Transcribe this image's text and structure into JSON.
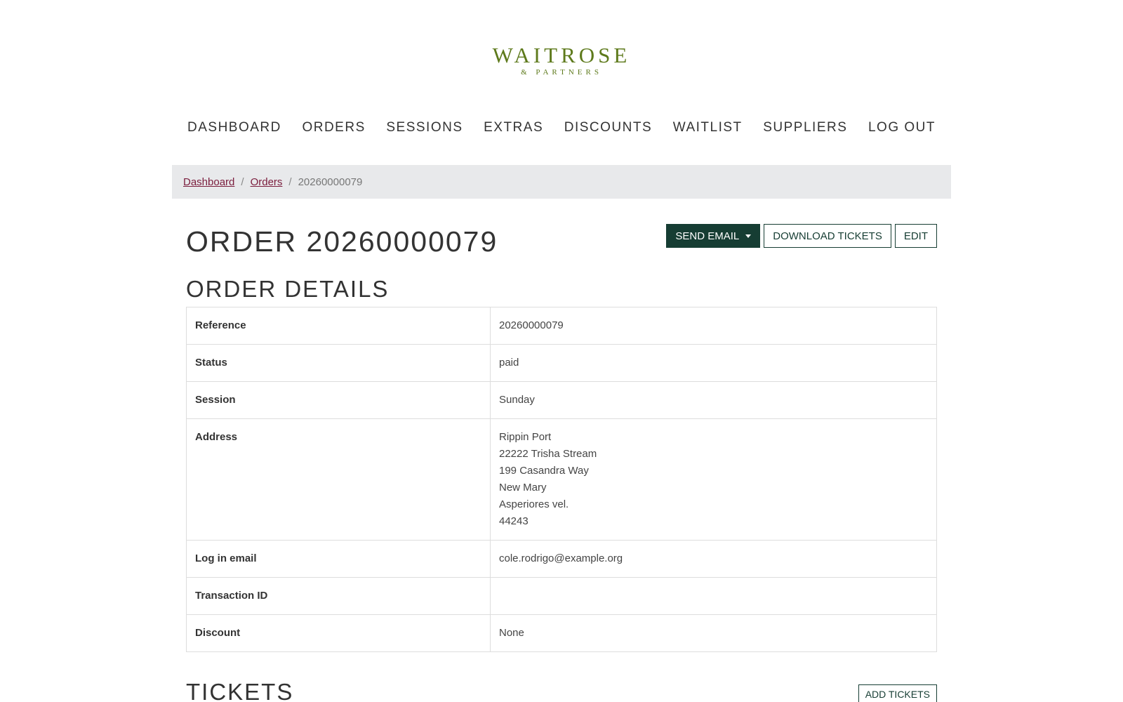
{
  "logo": {
    "main": "WAITROSE",
    "sub": "& PARTNERS"
  },
  "nav": [
    "DASHBOARD",
    "ORDERS",
    "SESSIONS",
    "EXTRAS",
    "DISCOUNTS",
    "WAITLIST",
    "SUPPLIERS",
    "LOG OUT"
  ],
  "breadcrumb": {
    "dashboard": "Dashboard",
    "orders": "Orders",
    "current": "20260000079",
    "separator": "/"
  },
  "page_title": "ORDER 20260000079",
  "actions": {
    "send_email": "SEND EMAIL",
    "download_tickets": "DOWNLOAD TICKETS",
    "edit": "EDIT"
  },
  "order_details": {
    "title": "ORDER DETAILS",
    "reference_label": "Reference",
    "reference": "20260000079",
    "status_label": "Status",
    "status": "paid",
    "session_label": "Session",
    "session": "Sunday",
    "address_label": "Address",
    "address": [
      "Rippin Port",
      "22222 Trisha Stream",
      "199 Casandra Way",
      "New Mary",
      "Asperiores vel.",
      "44243"
    ],
    "login_email_label": "Log in email",
    "login_email": "cole.rodrigo@example.org",
    "transaction_id_label": "Transaction ID",
    "transaction_id": "",
    "discount_label": "Discount",
    "discount": "None"
  },
  "tickets": {
    "title": "TICKETS",
    "add_label": "ADD TICKETS"
  },
  "colors": {
    "brand": "#5e7a1c",
    "primary": "#163d33",
    "link": "#7a1c3c",
    "breadcrumb_bg": "#e8e9eb"
  }
}
